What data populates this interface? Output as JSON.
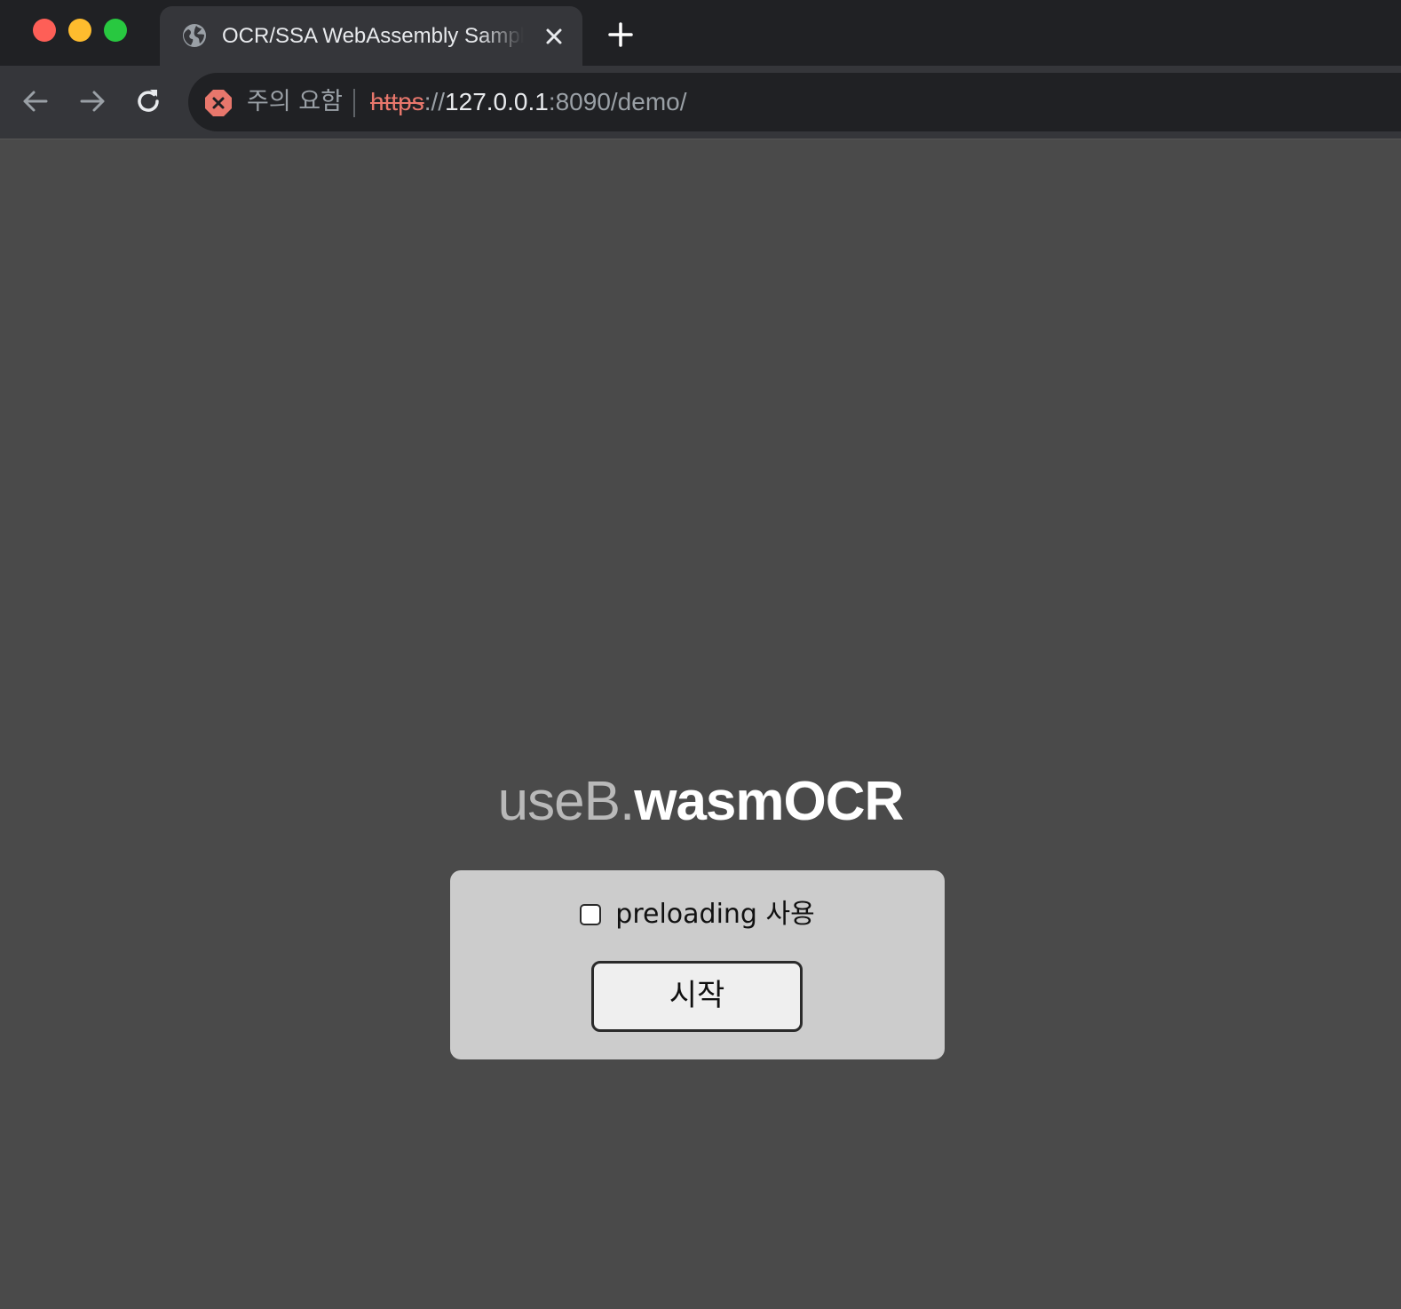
{
  "browser": {
    "tab": {
      "title": "OCR/SSA WebAssembly Sample",
      "favicon_icon": "globe-icon",
      "close_icon": "close-icon"
    },
    "new_tab_icon": "plus-icon",
    "nav": {
      "back_icon": "arrow-left-icon",
      "forward_icon": "arrow-right-icon",
      "reload_icon": "reload-icon"
    },
    "omnibox": {
      "security_icon": "not-secure-icon",
      "security_label": "주의 요함",
      "url_scheme": "https",
      "url_separator": "://",
      "url_host": "127.0.0.1",
      "url_rest": ":8090/demo/"
    },
    "colors": {
      "close_red": "#fe5f57",
      "minimize_yellow": "#febc2e",
      "zoom_green": "#28c840",
      "warning_red": "#e8776c"
    }
  },
  "page": {
    "logo": {
      "brand": "useB.",
      "product": "wasmOCR"
    },
    "preload_option": {
      "label": "preloading 사용",
      "checked": false
    },
    "start_button": {
      "label": "시작"
    }
  }
}
